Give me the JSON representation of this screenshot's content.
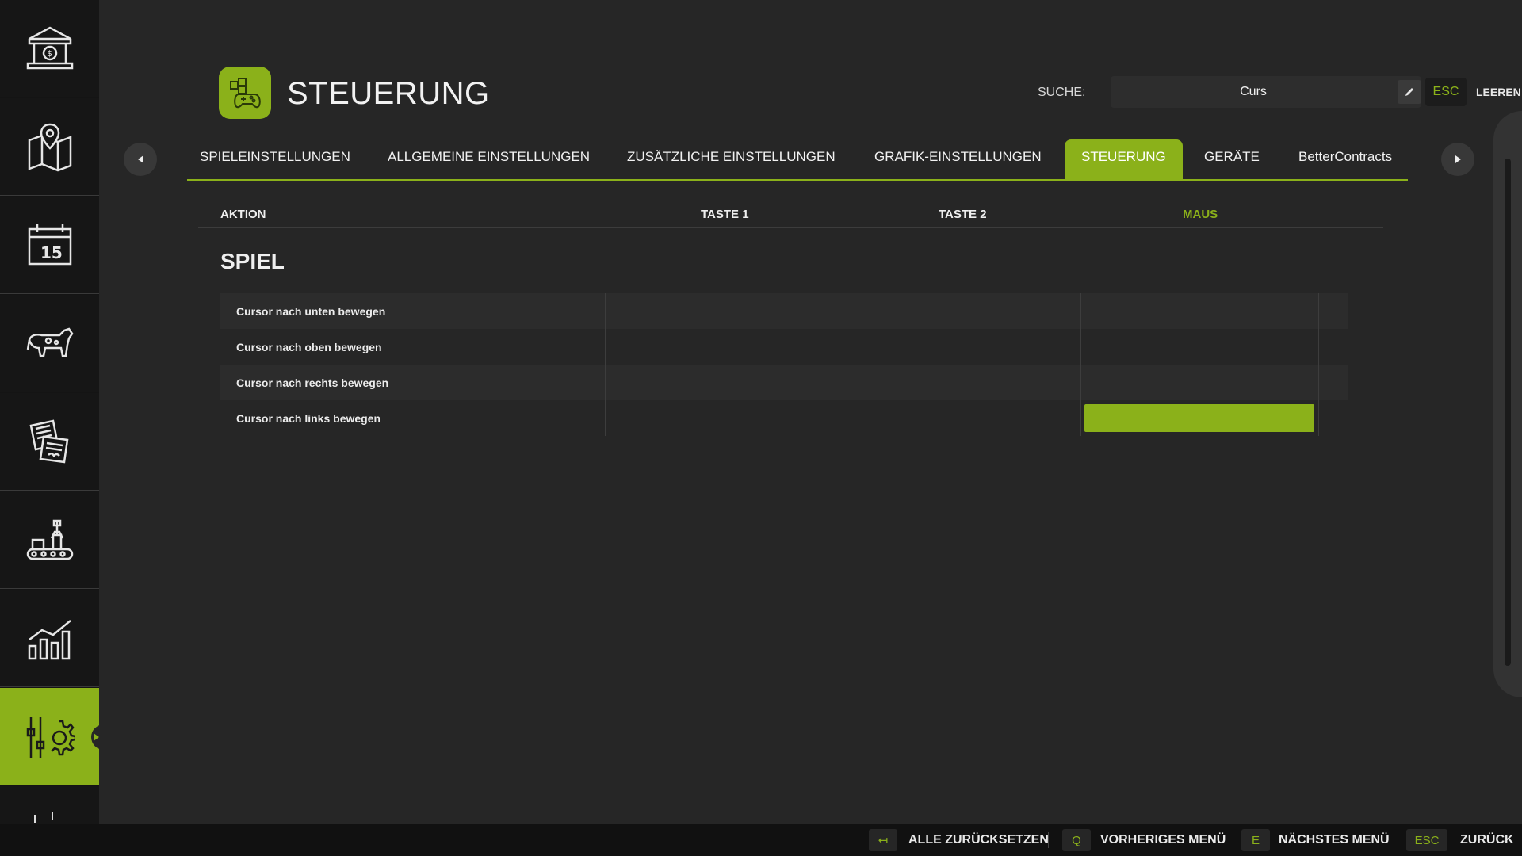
{
  "sidebar": {
    "items": [
      {
        "icon": "bank-icon"
      },
      {
        "icon": "map-icon"
      },
      {
        "icon": "calendar-icon",
        "day": "15"
      },
      {
        "icon": "cow-icon"
      },
      {
        "icon": "contracts-icon"
      },
      {
        "icon": "production-icon"
      },
      {
        "icon": "statistics-icon"
      },
      {
        "icon": "settings-icon",
        "active": true
      }
    ]
  },
  "header": {
    "title": "STEUERUNG",
    "icon": "gamepad-icon",
    "search_label": "SUCHE:",
    "search_value": "Curs",
    "esc_label": "ESC",
    "clear_label": "LEEREN"
  },
  "tabs": [
    {
      "label": "SPIELEINSTELLUNGEN"
    },
    {
      "label": "ALLGEMEINE EINSTELLUNGEN"
    },
    {
      "label": "ZUSÄTZLICHE EINSTELLUNGEN"
    },
    {
      "label": "GRAFIK-EINSTELLUNGEN"
    },
    {
      "label": "STEUERUNG",
      "active": true
    },
    {
      "label": "GERÄTE"
    },
    {
      "label": "BetterContracts"
    }
  ],
  "table": {
    "headers": {
      "action": "AKTION",
      "key1": "TASTE 1",
      "key2": "TASTE 2",
      "mouse": "MAUS"
    },
    "section": "SPIEL",
    "rows": [
      {
        "action": "Cursor nach unten bewegen",
        "key1": "",
        "key2": "",
        "mouse": ""
      },
      {
        "action": "Cursor nach oben bewegen",
        "key1": "",
        "key2": "",
        "mouse": ""
      },
      {
        "action": "Cursor nach rechts bewegen",
        "key1": "",
        "key2": "",
        "mouse": ""
      },
      {
        "action": "Cursor nach links bewegen",
        "key1": "",
        "key2": "",
        "mouse": "",
        "selected_column": "mouse"
      }
    ]
  },
  "footer": {
    "actions": [
      {
        "key": "↤",
        "label": "ALLE ZURÜCKSETZEN"
      },
      {
        "key": "Q",
        "label": "VORHERIGES MENÜ"
      },
      {
        "key": "E",
        "label": "NÄCHSTES MENÜ"
      },
      {
        "key": "ESC",
        "label": "ZURÜCK"
      }
    ]
  },
  "colors": {
    "accent": "#8bb11a",
    "background": "#262626",
    "sidebar": "#141414"
  }
}
